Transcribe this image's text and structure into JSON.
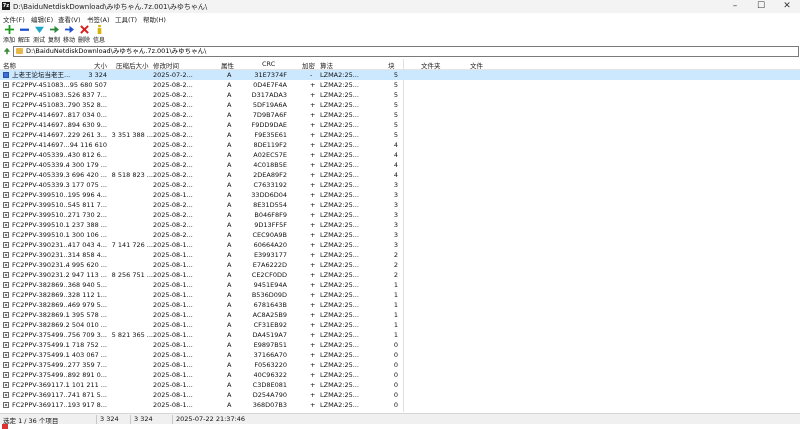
{
  "window": {
    "title": "D:\\BaiduNetdiskDownload\\みゆちゃん.7z.001\\みゆちゃん\\"
  },
  "menu": [
    "文件(F)",
    "编辑(E)",
    "查看(V)",
    "书签(A)",
    "工具(T)",
    "帮助(H)"
  ],
  "toolbar": [
    {
      "label": "添加",
      "icon": "add-icon",
      "color": "#1a9a1a"
    },
    {
      "label": "解压",
      "icon": "extract-icon",
      "color": "#1f4fd1"
    },
    {
      "label": "测试",
      "icon": "test-icon",
      "color": "#1fa6c9"
    },
    {
      "label": "复制",
      "icon": "copy-icon",
      "color": "#2a8a3a"
    },
    {
      "label": "移动",
      "icon": "move-icon",
      "color": "#1f4fd1"
    },
    {
      "label": "删除",
      "icon": "delete-icon",
      "color": "#d61f1f"
    },
    {
      "label": "信息",
      "icon": "info-icon",
      "color": "#d9b300"
    }
  ],
  "address": {
    "path": "D:\\BaiduNetdiskDownload\\みゆちゃん.7z.001\\みゆちゃん\\"
  },
  "columns": [
    "名称",
    "大小",
    "压缩后大小",
    "修改时间",
    "属性",
    "CRC",
    "加密",
    "算法",
    "块",
    "文件夹",
    "文件"
  ],
  "rows": [
    {
      "name": "上老王论坛当老王...",
      "size": "3 324",
      "packed": "",
      "mtime": "2025-07-2...",
      "attr": "A",
      "crc": "31E7374F",
      "enc": "-",
      "method": "LZMA2:25...",
      "block": "5",
      "selected": true,
      "kind": "text"
    },
    {
      "name": "FC2PPV-451083...",
      "size": "95 680 507",
      "packed": "",
      "mtime": "2025-08-2...",
      "attr": "A",
      "crc": "0D4E7F4A",
      "enc": "+",
      "method": "LZMA2:25...",
      "block": "5"
    },
    {
      "name": "FC2PPV-451083...",
      "size": "526 837 7...",
      "packed": "",
      "mtime": "2025-08-2...",
      "attr": "A",
      "crc": "D317ADA3",
      "enc": "+",
      "method": "LZMA2:25...",
      "block": "5"
    },
    {
      "name": "FC2PPV-451083...",
      "size": "790 352 8...",
      "packed": "",
      "mtime": "2025-08-2...",
      "attr": "A",
      "crc": "5DF19A6A",
      "enc": "+",
      "method": "LZMA2:25...",
      "block": "5"
    },
    {
      "name": "FC2PPV-414697...",
      "size": "817 034 0...",
      "packed": "",
      "mtime": "2025-08-2...",
      "attr": "A",
      "crc": "7D9B7A6F",
      "enc": "+",
      "method": "LZMA2:25...",
      "block": "5"
    },
    {
      "name": "FC2PPV-414697...",
      "size": "894 630 9...",
      "packed": "",
      "mtime": "2025-08-2...",
      "attr": "A",
      "crc": "F9DD9DAE",
      "enc": "+",
      "method": "LZMA2:25...",
      "block": "5"
    },
    {
      "name": "FC2PPV-414697...",
      "size": "229 261 3...",
      "packed": "3 351 388 ...",
      "mtime": "2025-08-2...",
      "attr": "A",
      "crc": "F9E35E61",
      "enc": "+",
      "method": "LZMA2:25...",
      "block": "5"
    },
    {
      "name": "FC2PPV-414697...",
      "size": "94 116 610",
      "packed": "",
      "mtime": "2025-08-2...",
      "attr": "A",
      "crc": "8DE119F2",
      "enc": "+",
      "method": "LZMA2:25...",
      "block": "4"
    },
    {
      "name": "FC2PPV-405339...",
      "size": "430 812 6...",
      "packed": "",
      "mtime": "2025-08-2...",
      "attr": "A",
      "crc": "A02EC57E",
      "enc": "+",
      "method": "LZMA2:25...",
      "block": "4"
    },
    {
      "name": "FC2PPV-405339...",
      "size": "4 300 179 ...",
      "packed": "",
      "mtime": "2025-08-2...",
      "attr": "A",
      "crc": "4C018B5E",
      "enc": "+",
      "method": "LZMA2:25...",
      "block": "4"
    },
    {
      "name": "FC2PPV-405339...",
      "size": "3 696 420 ...",
      "packed": "8 518 823 ...",
      "mtime": "2025-08-2...",
      "attr": "A",
      "crc": "2DEA89F2",
      "enc": "+",
      "method": "LZMA2:25...",
      "block": "4"
    },
    {
      "name": "FC2PPV-405339...",
      "size": "3 177 075 ...",
      "packed": "",
      "mtime": "2025-08-2...",
      "attr": "A",
      "crc": "C7633192",
      "enc": "+",
      "method": "LZMA2:25...",
      "block": "3"
    },
    {
      "name": "FC2PPV-399510...",
      "size": "195 996 4...",
      "packed": "",
      "mtime": "2025-08-1...",
      "attr": "A",
      "crc": "33DD6D04",
      "enc": "+",
      "method": "LZMA2:25...",
      "block": "3"
    },
    {
      "name": "FC2PPV-399510...",
      "size": "545 811 7...",
      "packed": "",
      "mtime": "2025-08-2...",
      "attr": "A",
      "crc": "8E31D554",
      "enc": "+",
      "method": "LZMA2:25...",
      "block": "3"
    },
    {
      "name": "FC2PPV-399510...",
      "size": "271 730 2...",
      "packed": "",
      "mtime": "2025-08-2...",
      "attr": "A",
      "crc": "B046F8F9",
      "enc": "+",
      "method": "LZMA2:25...",
      "block": "3"
    },
    {
      "name": "FC2PPV-399510...",
      "size": "1 237 388 ...",
      "packed": "",
      "mtime": "2025-08-2...",
      "attr": "A",
      "crc": "9D13FF5F",
      "enc": "+",
      "method": "LZMA2:25...",
      "block": "3"
    },
    {
      "name": "FC2PPV-399510...",
      "size": "1 300 106 ...",
      "packed": "",
      "mtime": "2025-08-2...",
      "attr": "A",
      "crc": "CEC90A9B",
      "enc": "+",
      "method": "LZMA2:25...",
      "block": "3"
    },
    {
      "name": "FC2PPV-390231...",
      "size": "417 043 4...",
      "packed": "7 141 726 ...",
      "mtime": "2025-08-1...",
      "attr": "A",
      "crc": "60664A20",
      "enc": "+",
      "method": "LZMA2:25...",
      "block": "3"
    },
    {
      "name": "FC2PPV-390231...",
      "size": "314 858 4...",
      "packed": "",
      "mtime": "2025-08-1...",
      "attr": "A",
      "crc": "E3993177",
      "enc": "+",
      "method": "LZMA2:25...",
      "block": "2"
    },
    {
      "name": "FC2PPV-390231...",
      "size": "4 995 620 ...",
      "packed": "",
      "mtime": "2025-08-1...",
      "attr": "A",
      "crc": "E7A6222D",
      "enc": "+",
      "method": "LZMA2:25...",
      "block": "2"
    },
    {
      "name": "FC2PPV-390231...",
      "size": "2 947 113 ...",
      "packed": "8 256 751 ...",
      "mtime": "2025-08-1...",
      "attr": "A",
      "crc": "CE2CF0DD",
      "enc": "+",
      "method": "LZMA2:25...",
      "block": "2"
    },
    {
      "name": "FC2PPV-382869...",
      "size": "368 940 5...",
      "packed": "",
      "mtime": "2025-08-1...",
      "attr": "A",
      "crc": "9451E94A",
      "enc": "+",
      "method": "LZMA2:25...",
      "block": "1"
    },
    {
      "name": "FC2PPV-382869...",
      "size": "328 112 1...",
      "packed": "",
      "mtime": "2025-08-1...",
      "attr": "A",
      "crc": "B536D09D",
      "enc": "+",
      "method": "LZMA2:25...",
      "block": "1"
    },
    {
      "name": "FC2PPV-382869...",
      "size": "469 979 5...",
      "packed": "",
      "mtime": "2025-08-1...",
      "attr": "A",
      "crc": "6781643B",
      "enc": "+",
      "method": "LZMA2:25...",
      "block": "1"
    },
    {
      "name": "FC2PPV-382869...",
      "size": "1 395 578 ...",
      "packed": "",
      "mtime": "2025-08-1...",
      "attr": "A",
      "crc": "AC8A25B9",
      "enc": "+",
      "method": "LZMA2:25...",
      "block": "1"
    },
    {
      "name": "FC2PPV-382869...",
      "size": "2 504 010 ...",
      "packed": "",
      "mtime": "2025-08-1...",
      "attr": "A",
      "crc": "CF31EB92",
      "enc": "+",
      "method": "LZMA2:25...",
      "block": "1"
    },
    {
      "name": "FC2PPV-375499...",
      "size": "756 709 3...",
      "packed": "5 821 365 ...",
      "mtime": "2025-08-1...",
      "attr": "A",
      "crc": "DA4519A7",
      "enc": "+",
      "method": "LZMA2:25...",
      "block": "1"
    },
    {
      "name": "FC2PPV-375499...",
      "size": "1 718 752 ...",
      "packed": "",
      "mtime": "2025-08-1...",
      "attr": "A",
      "crc": "E9897B51",
      "enc": "+",
      "method": "LZMA2:25...",
      "block": "0"
    },
    {
      "name": "FC2PPV-375499...",
      "size": "1 403 067 ...",
      "packed": "",
      "mtime": "2025-08-1...",
      "attr": "A",
      "crc": "37166A70",
      "enc": "+",
      "method": "LZMA2:25...",
      "block": "0"
    },
    {
      "name": "FC2PPV-375499...",
      "size": "277 359 7...",
      "packed": "",
      "mtime": "2025-08-1...",
      "attr": "A",
      "crc": "F0563220",
      "enc": "+",
      "method": "LZMA2:25...",
      "block": "0"
    },
    {
      "name": "FC2PPV-375499...",
      "size": "892 891 0...",
      "packed": "",
      "mtime": "2025-08-1...",
      "attr": "A",
      "crc": "40C96322",
      "enc": "+",
      "method": "LZMA2:25...",
      "block": "0"
    },
    {
      "name": "FC2PPV-369117...",
      "size": "1 101 211 ...",
      "packed": "",
      "mtime": "2025-08-1...",
      "attr": "A",
      "crc": "C3D8E081",
      "enc": "+",
      "method": "LZMA2:25...",
      "block": "0"
    },
    {
      "name": "FC2PPV-369117...",
      "size": "741 871 5...",
      "packed": "",
      "mtime": "2025-08-1...",
      "attr": "A",
      "crc": "D254A790",
      "enc": "+",
      "method": "LZMA2:25...",
      "block": "0"
    },
    {
      "name": "FC2PPV-369117...",
      "size": "193 917 8...",
      "packed": "",
      "mtime": "2025-08-1...",
      "attr": "A",
      "crc": "368D07B3",
      "enc": "+",
      "method": "LZMA2:25...",
      "block": "0"
    }
  ],
  "status": {
    "selection": "选定 1 / 36 个项目",
    "size": "3 324",
    "packed": "3 324",
    "mtime": "2025-07-22 21:37:46"
  },
  "colors": {
    "selected_row": "#cce8ff",
    "folder": "#e8b84a"
  }
}
